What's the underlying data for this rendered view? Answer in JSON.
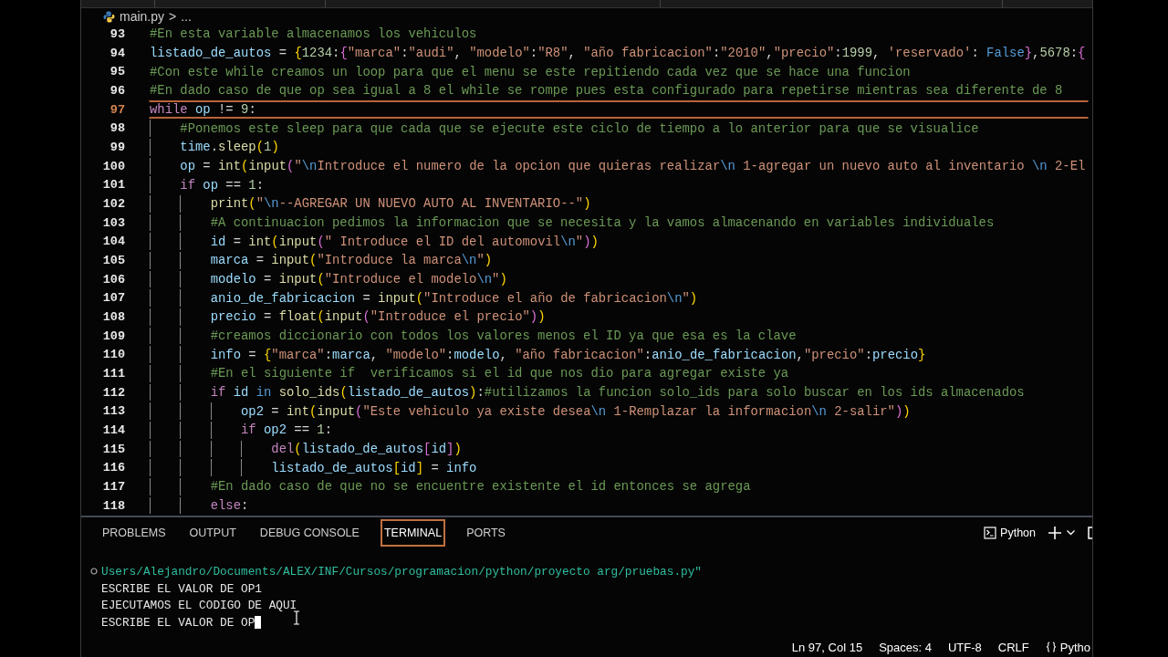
{
  "breadcrumb": {
    "file": "main.py",
    "separator": ">",
    "rest": "..."
  },
  "editor": {
    "lines": [
      {
        "number": "93",
        "current": false,
        "tokens": [
          {
            "kind": "comment",
            "text": "#En esta variable almacenamos los vehiculos"
          }
        ]
      },
      {
        "number": "94",
        "current": false,
        "tokens": [
          {
            "kind": "variable",
            "text": "listado_de_autos"
          },
          {
            "kind": "plain",
            "text": " = "
          },
          {
            "kind": "bracket",
            "text": "{"
          },
          {
            "kind": "number",
            "text": "1234"
          },
          {
            "kind": "plain",
            "text": ":"
          },
          {
            "kind": "bracket2",
            "text": "{"
          },
          {
            "kind": "string",
            "text": "\"marca\""
          },
          {
            "kind": "plain",
            "text": ":"
          },
          {
            "kind": "string",
            "text": "\"audi\""
          },
          {
            "kind": "plain",
            "text": ", "
          },
          {
            "kind": "string",
            "text": "\"modelo\""
          },
          {
            "kind": "plain",
            "text": ":"
          },
          {
            "kind": "string",
            "text": "\"R8\""
          },
          {
            "kind": "plain",
            "text": ", "
          },
          {
            "kind": "string",
            "text": "\"año fabricacion\""
          },
          {
            "kind": "plain",
            "text": ":"
          },
          {
            "kind": "string",
            "text": "\"2010\""
          },
          {
            "kind": "plain",
            "text": ","
          },
          {
            "kind": "string",
            "text": "\"precio\""
          },
          {
            "kind": "plain",
            "text": ":"
          },
          {
            "kind": "number",
            "text": "1999"
          },
          {
            "kind": "plain",
            "text": ", "
          },
          {
            "kind": "string",
            "text": "'reservado'"
          },
          {
            "kind": "plain",
            "text": ": "
          },
          {
            "kind": "constant",
            "text": "False"
          },
          {
            "kind": "bracket2",
            "text": "}"
          },
          {
            "kind": "plain",
            "text": ","
          },
          {
            "kind": "number",
            "text": "5678"
          },
          {
            "kind": "plain",
            "text": ":"
          },
          {
            "kind": "bracket2",
            "text": "{"
          }
        ]
      },
      {
        "number": "95",
        "current": false,
        "tokens": [
          {
            "kind": "comment",
            "text": "#Con este while creamos un loop para que el menu se este repitiendo cada vez que se hace una funcion"
          }
        ]
      },
      {
        "number": "96",
        "current": false,
        "tokens": [
          {
            "kind": "comment",
            "text": "#En dado caso de que op sea igual a 8 el while se rompe pues esta configurado para repetirse mientras sea diferente de 8"
          }
        ]
      },
      {
        "number": "97",
        "current": true,
        "tokens": [
          {
            "kind": "keyword",
            "text": "while "
          },
          {
            "kind": "variable",
            "text": "op"
          },
          {
            "kind": "plain",
            "text": " != "
          },
          {
            "kind": "number",
            "text": "9"
          },
          {
            "kind": "plain",
            "text": ":"
          }
        ],
        "children": [
          {
            "number": "98",
            "current": false,
            "tokens": [
              {
                "kind": "comment",
                "text": "#Ponemos este sleep para que cada que se ejecute este ciclo de tiempo a lo anterior para que se visualice"
              }
            ]
          },
          {
            "number": "99",
            "current": false,
            "tokens": [
              {
                "kind": "variable",
                "text": "time"
              },
              {
                "kind": "plain",
                "text": "."
              },
              {
                "kind": "function",
                "text": "sleep"
              },
              {
                "kind": "bracket",
                "text": "("
              },
              {
                "kind": "number",
                "text": "1"
              },
              {
                "kind": "bracket",
                "text": ")"
              }
            ]
          },
          {
            "number": "100",
            "current": false,
            "tokens": [
              {
                "kind": "variable",
                "text": "op"
              },
              {
                "kind": "plain",
                "text": " = "
              },
              {
                "kind": "function",
                "text": "int"
              },
              {
                "kind": "bracket",
                "text": "("
              },
              {
                "kind": "function",
                "text": "input"
              },
              {
                "kind": "bracket2",
                "text": "("
              },
              {
                "kind": "string",
                "text": "\""
              },
              {
                "kind": "escape",
                "text": "\\n"
              },
              {
                "kind": "string",
                "text": "Introduce el numero de la opcion que quieras realizar"
              },
              {
                "kind": "escape",
                "text": "\\n"
              },
              {
                "kind": "string",
                "text": " 1-agregar un nuevo auto al inventario "
              },
              {
                "kind": "escape",
                "text": "\\n"
              },
              {
                "kind": "string",
                "text": " 2-El"
              }
            ]
          },
          {
            "number": "101",
            "current": false,
            "tokens": [
              {
                "kind": "keyword",
                "text": "if "
              },
              {
                "kind": "variable",
                "text": "op"
              },
              {
                "kind": "plain",
                "text": " == "
              },
              {
                "kind": "number",
                "text": "1"
              },
              {
                "kind": "plain",
                "text": ":"
              }
            ],
            "children": [
              {
                "number": "102",
                "current": false,
                "tokens": [
                  {
                    "kind": "function",
                    "text": "print"
                  },
                  {
                    "kind": "bracket",
                    "text": "("
                  },
                  {
                    "kind": "string",
                    "text": "\""
                  },
                  {
                    "kind": "escape",
                    "text": "\\n"
                  },
                  {
                    "kind": "string",
                    "text": "--AGREGAR UN NUEVO AUTO AL INVENTARIO--\""
                  },
                  {
                    "kind": "bracket",
                    "text": ")"
                  }
                ]
              },
              {
                "number": "103",
                "current": false,
                "tokens": [
                  {
                    "kind": "comment",
                    "text": "#A continuacion pedimos la informacion que se necesita y la vamos almacenando en variables individuales"
                  }
                ]
              },
              {
                "number": "104",
                "current": false,
                "tokens": [
                  {
                    "kind": "variable",
                    "text": "id"
                  },
                  {
                    "kind": "plain",
                    "text": " = "
                  },
                  {
                    "kind": "function",
                    "text": "int"
                  },
                  {
                    "kind": "bracket",
                    "text": "("
                  },
                  {
                    "kind": "function",
                    "text": "input"
                  },
                  {
                    "kind": "bracket2",
                    "text": "("
                  },
                  {
                    "kind": "string",
                    "text": "\" Introduce el ID del automovil"
                  },
                  {
                    "kind": "escape",
                    "text": "\\n"
                  },
                  {
                    "kind": "string",
                    "text": "\""
                  },
                  {
                    "kind": "bracket2",
                    "text": ")"
                  },
                  {
                    "kind": "bracket",
                    "text": ")"
                  }
                ]
              },
              {
                "number": "105",
                "current": false,
                "tokens": [
                  {
                    "kind": "variable",
                    "text": "marca"
                  },
                  {
                    "kind": "plain",
                    "text": " = "
                  },
                  {
                    "kind": "function",
                    "text": "input"
                  },
                  {
                    "kind": "bracket",
                    "text": "("
                  },
                  {
                    "kind": "string",
                    "text": "\"Introduce la marca"
                  },
                  {
                    "kind": "escape",
                    "text": "\\n"
                  },
                  {
                    "kind": "string",
                    "text": "\""
                  },
                  {
                    "kind": "bracket",
                    "text": ")"
                  }
                ]
              },
              {
                "number": "106",
                "current": false,
                "tokens": [
                  {
                    "kind": "variable",
                    "text": "modelo"
                  },
                  {
                    "kind": "plain",
                    "text": " = "
                  },
                  {
                    "kind": "function",
                    "text": "input"
                  },
                  {
                    "kind": "bracket",
                    "text": "("
                  },
                  {
                    "kind": "string",
                    "text": "\"Introduce el modelo"
                  },
                  {
                    "kind": "escape",
                    "text": "\\n"
                  },
                  {
                    "kind": "string",
                    "text": "\""
                  },
                  {
                    "kind": "bracket",
                    "text": ")"
                  }
                ]
              },
              {
                "number": "107",
                "current": false,
                "tokens": [
                  {
                    "kind": "variable",
                    "text": "anio_de_fabricacion"
                  },
                  {
                    "kind": "plain",
                    "text": " = "
                  },
                  {
                    "kind": "function",
                    "text": "input"
                  },
                  {
                    "kind": "bracket",
                    "text": "("
                  },
                  {
                    "kind": "string",
                    "text": "\"Introduce el año de fabricacion"
                  },
                  {
                    "kind": "escape",
                    "text": "\\n"
                  },
                  {
                    "kind": "string",
                    "text": "\""
                  },
                  {
                    "kind": "bracket",
                    "text": ")"
                  }
                ]
              },
              {
                "number": "108",
                "current": false,
                "tokens": [
                  {
                    "kind": "variable",
                    "text": "precio"
                  },
                  {
                    "kind": "plain",
                    "text": " = "
                  },
                  {
                    "kind": "function",
                    "text": "float"
                  },
                  {
                    "kind": "bracket",
                    "text": "("
                  },
                  {
                    "kind": "function",
                    "text": "input"
                  },
                  {
                    "kind": "bracket2",
                    "text": "("
                  },
                  {
                    "kind": "string",
                    "text": "\"Introduce el precio\""
                  },
                  {
                    "kind": "bracket2",
                    "text": ")"
                  },
                  {
                    "kind": "bracket",
                    "text": ")"
                  }
                ]
              },
              {
                "number": "109",
                "current": false,
                "tokens": [
                  {
                    "kind": "comment",
                    "text": "#creamos diccionario con todos los valores menos el ID ya que esa es la clave"
                  }
                ]
              },
              {
                "number": "110",
                "current": false,
                "tokens": [
                  {
                    "kind": "variable",
                    "text": "info"
                  },
                  {
                    "kind": "plain",
                    "text": " = "
                  },
                  {
                    "kind": "bracket",
                    "text": "{"
                  },
                  {
                    "kind": "string",
                    "text": "\"marca\""
                  },
                  {
                    "kind": "plain",
                    "text": ":"
                  },
                  {
                    "kind": "variable",
                    "text": "marca"
                  },
                  {
                    "kind": "plain",
                    "text": ", "
                  },
                  {
                    "kind": "string",
                    "text": "\"modelo\""
                  },
                  {
                    "kind": "plain",
                    "text": ":"
                  },
                  {
                    "kind": "variable",
                    "text": "modelo"
                  },
                  {
                    "kind": "plain",
                    "text": ", "
                  },
                  {
                    "kind": "string",
                    "text": "\"año fabricacion\""
                  },
                  {
                    "kind": "plain",
                    "text": ":"
                  },
                  {
                    "kind": "variable",
                    "text": "anio_de_fabricacion"
                  },
                  {
                    "kind": "plain",
                    "text": ","
                  },
                  {
                    "kind": "string",
                    "text": "\"precio\""
                  },
                  {
                    "kind": "plain",
                    "text": ":"
                  },
                  {
                    "kind": "variable",
                    "text": "precio"
                  },
                  {
                    "kind": "bracket",
                    "text": "}"
                  }
                ]
              },
              {
                "number": "111",
                "current": false,
                "tokens": [
                  {
                    "kind": "comment",
                    "text": "#En el siguiente if  verificamos si el id que nos dio para agregar existe ya"
                  }
                ]
              },
              {
                "number": "112",
                "current": false,
                "tokens": [
                  {
                    "kind": "keyword",
                    "text": "if "
                  },
                  {
                    "kind": "variable",
                    "text": "id "
                  },
                  {
                    "kind": "constant",
                    "text": "in "
                  },
                  {
                    "kind": "function",
                    "text": "solo_ids"
                  },
                  {
                    "kind": "bracket",
                    "text": "("
                  },
                  {
                    "kind": "variable",
                    "text": "listado_de_autos"
                  },
                  {
                    "kind": "bracket",
                    "text": ")"
                  },
                  {
                    "kind": "plain",
                    "text": ":"
                  },
                  {
                    "kind": "comment",
                    "text": "#utilizamos la funcion solo_ids para solo buscar en los ids almacenados"
                  }
                ],
                "children": [
                  {
                    "number": "113",
                    "current": false,
                    "tokens": [
                      {
                        "kind": "variable",
                        "text": "op2"
                      },
                      {
                        "kind": "plain",
                        "text": " = "
                      },
                      {
                        "kind": "function",
                        "text": "int"
                      },
                      {
                        "kind": "bracket",
                        "text": "("
                      },
                      {
                        "kind": "function",
                        "text": "input"
                      },
                      {
                        "kind": "bracket2",
                        "text": "("
                      },
                      {
                        "kind": "string",
                        "text": "\"Este vehiculo ya existe desea"
                      },
                      {
                        "kind": "escape",
                        "text": "\\n"
                      },
                      {
                        "kind": "string",
                        "text": " 1-Remplazar la informacion"
                      },
                      {
                        "kind": "escape",
                        "text": "\\n"
                      },
                      {
                        "kind": "string",
                        "text": " 2-salir\""
                      },
                      {
                        "kind": "bracket2",
                        "text": ")"
                      },
                      {
                        "kind": "bracket",
                        "text": ")"
                      }
                    ]
                  },
                  {
                    "number": "114",
                    "current": false,
                    "tokens": [
                      {
                        "kind": "keyword",
                        "text": "if "
                      },
                      {
                        "kind": "variable",
                        "text": "op2"
                      },
                      {
                        "kind": "plain",
                        "text": " == "
                      },
                      {
                        "kind": "number",
                        "text": "1"
                      },
                      {
                        "kind": "plain",
                        "text": ":"
                      }
                    ],
                    "children": [
                      {
                        "number": "115",
                        "current": false,
                        "tokens": [
                          {
                            "kind": "keyword",
                            "text": "del"
                          },
                          {
                            "kind": "bracket",
                            "text": "("
                          },
                          {
                            "kind": "variable",
                            "text": "listado_de_autos"
                          },
                          {
                            "kind": "bracket2",
                            "text": "["
                          },
                          {
                            "kind": "variable",
                            "text": "id"
                          },
                          {
                            "kind": "bracket2",
                            "text": "]"
                          },
                          {
                            "kind": "bracket",
                            "text": ")"
                          }
                        ]
                      },
                      {
                        "number": "116",
                        "current": false,
                        "tokens": [
                          {
                            "kind": "variable",
                            "text": "listado_de_autos"
                          },
                          {
                            "kind": "bracket",
                            "text": "["
                          },
                          {
                            "kind": "variable",
                            "text": "id"
                          },
                          {
                            "kind": "bracket",
                            "text": "]"
                          },
                          {
                            "kind": "plain",
                            "text": " = "
                          },
                          {
                            "kind": "variable",
                            "text": "info"
                          }
                        ]
                      }
                    ]
                  }
                ]
              },
              {
                "number": "117",
                "current": false,
                "tokens": [
                  {
                    "kind": "comment",
                    "text": "#En dado caso de que no se encuentre existente el id entonces se agrega"
                  }
                ]
              },
              {
                "number": "118",
                "current": false,
                "tokens": [
                  {
                    "kind": "keyword",
                    "text": "else"
                  },
                  {
                    "kind": "plain",
                    "text": ":"
                  }
                ]
              }
            ]
          }
        ]
      }
    ]
  },
  "panel": {
    "tabs": [
      {
        "label": "PROBLEMS",
        "selected": false
      },
      {
        "label": "OUTPUT",
        "selected": false
      },
      {
        "label": "DEBUG CONSOLE",
        "selected": false
      },
      {
        "label": "TERMINAL",
        "selected": true
      },
      {
        "label": "PORTS",
        "selected": false
      }
    ],
    "terminal_profile": "Python",
    "terminal_lines": [
      {
        "kind": "path",
        "text": "Users/Alejandro/Documents/ALEX/INF/Cursos/programacion/python/proyecto arg/pruebas.py\""
      },
      {
        "kind": "output",
        "text": "ESCRIBE EL VALOR DE OP1"
      },
      {
        "kind": "output",
        "text": "EJECUTAMOS EL CODIGO DE AQUI"
      },
      {
        "kind": "prompt",
        "text": "ESCRIBE EL VALOR DE OP"
      }
    ]
  },
  "status_bar": {
    "position": "Ln 97, Col 15",
    "indentation": "Spaces: 4",
    "encoding": "UTF-8",
    "line_ending": "CRLF",
    "language": "Pytho"
  }
}
